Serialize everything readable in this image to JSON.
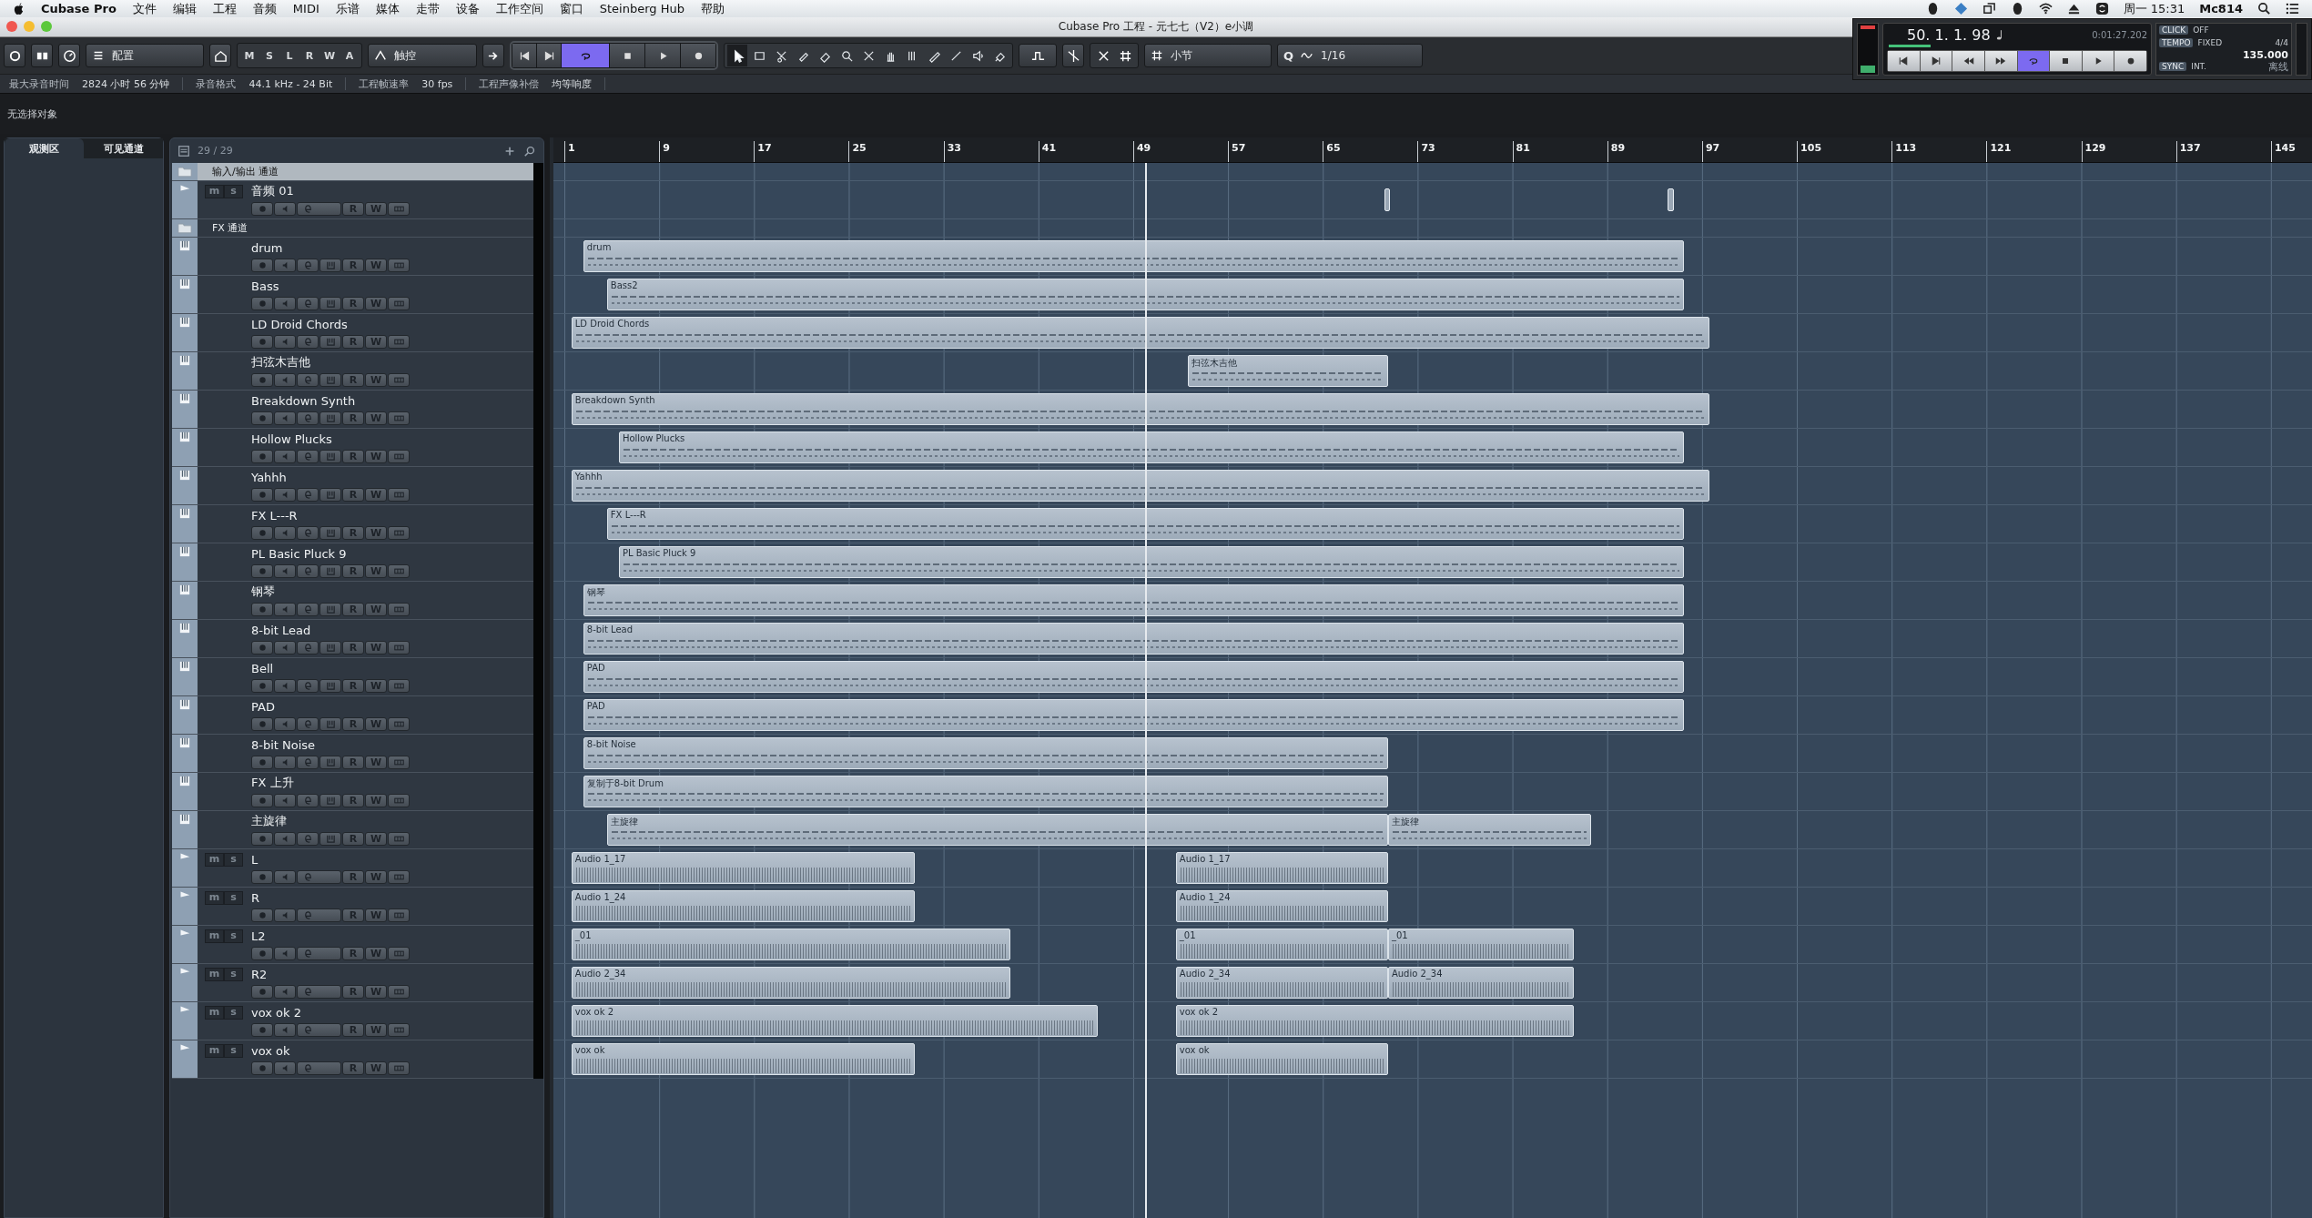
{
  "menu_bar": {
    "app": "Cubase Pro",
    "items": [
      "文件",
      "编辑",
      "工程",
      "音频",
      "MIDI",
      "乐谱",
      "媒体",
      "走带",
      "设备",
      "工作空间",
      "窗口",
      "Steinberg Hub",
      "帮助"
    ],
    "clock": "周一 15:31",
    "user": "Mc814"
  },
  "window": {
    "title": "Cubase Pro 工程 - 元七七（V2）e小调"
  },
  "toolbar": {
    "preset": "配置",
    "modes": [
      "M",
      "S",
      "L",
      "R",
      "W",
      "A"
    ],
    "automation": "触控",
    "transport": [
      {
        "kind": "to-start",
        "on": false
      },
      {
        "kind": "to-end",
        "on": false
      },
      {
        "kind": "cycle",
        "on": true
      },
      {
        "kind": "stop",
        "on": false
      },
      {
        "kind": "play",
        "on": false
      },
      {
        "kind": "record",
        "on": false
      }
    ],
    "grid": "小节",
    "quantize_label": "Q",
    "quantize": "1/16"
  },
  "info_line": [
    {
      "label": "最大录音时间",
      "value": "2824 小时 56 分钟"
    },
    {
      "label": "录音格式",
      "value": "44.1 kHz - 24 Bit"
    },
    {
      "label": "工程帧速率",
      "value": "30 fps"
    },
    {
      "label": "工程声像补偿",
      "value": "均等响度"
    }
  ],
  "selection_status": "无选择对象",
  "inspector": {
    "tabs": [
      {
        "label": "观测区",
        "selected": true
      },
      {
        "label": "可见通道",
        "selected": false
      }
    ]
  },
  "track_list": {
    "count": "29 / 29",
    "tracks": [
      {
        "kind": "folder",
        "name": "输入/输出 通道",
        "selected": true
      },
      {
        "kind": "audio",
        "name": "音频 01",
        "selected": false,
        "mute": "m",
        "solo": "s",
        "read": "R",
        "write": "W",
        "clips": [
          {
            "kind": "marker"
          },
          {
            "kind": "marker"
          }
        ]
      },
      {
        "kind": "folder",
        "name": "FX 通道",
        "selected": false
      },
      {
        "kind": "instrument",
        "name": "drum",
        "selected": false,
        "read": "R",
        "write": "W",
        "clips": [
          {
            "name": "drum"
          }
        ]
      },
      {
        "kind": "instrument",
        "name": "Bass",
        "selected": false,
        "read": "R",
        "write": "W",
        "clips": [
          {
            "name": "Bass2"
          }
        ]
      },
      {
        "kind": "instrument",
        "name": "LD Droid Chords",
        "selected": false,
        "read": "R",
        "write": "W",
        "clips": [
          {
            "name": "LD Droid Chords"
          }
        ]
      },
      {
        "kind": "instrument",
        "name": "扫弦木吉他",
        "selected": false,
        "read": "R",
        "write": "W",
        "clips": [
          {
            "name": "扫弦木吉他"
          }
        ]
      },
      {
        "kind": "instrument",
        "name": "Breakdown Synth",
        "selected": false,
        "read": "R",
        "write": "W",
        "clips": [
          {
            "name": "Breakdown Synth"
          }
        ]
      },
      {
        "kind": "instrument",
        "name": "Hollow Plucks",
        "selected": false,
        "read": "R",
        "write": "W",
        "clips": [
          {
            "name": "Hollow Plucks"
          }
        ]
      },
      {
        "kind": "instrument",
        "name": "Yahhh",
        "selected": false,
        "read": "R",
        "write": "W",
        "clips": [
          {
            "name": "Yahhh"
          }
        ]
      },
      {
        "kind": "instrument",
        "name": "FX L---R",
        "selected": false,
        "read": "R",
        "write": "W",
        "clips": [
          {
            "name": "FX L---R"
          }
        ]
      },
      {
        "kind": "instrument",
        "name": "PL Basic Pluck 9",
        "selected": false,
        "read": "R",
        "write": "W",
        "clips": [
          {
            "name": "PL Basic Pluck 9"
          }
        ]
      },
      {
        "kind": "instrument",
        "name": "钢琴",
        "selected": false,
        "read": "R",
        "write": "W",
        "clips": [
          {
            "name": "钢琴"
          }
        ]
      },
      {
        "kind": "instrument",
        "name": "8-bit Lead",
        "selected": false,
        "read": "R",
        "write": "W",
        "clips": [
          {
            "name": "8-bit Lead"
          }
        ]
      },
      {
        "kind": "instrument",
        "name": "Bell",
        "selected": false,
        "read": "R",
        "write": "W",
        "clips": [
          {
            "name": "PAD"
          }
        ]
      },
      {
        "kind": "instrument",
        "name": "PAD",
        "selected": false,
        "read": "R",
        "write": "W",
        "clips": [
          {
            "name": "PAD"
          }
        ]
      },
      {
        "kind": "instrument",
        "name": "8-bit Noise",
        "selected": false,
        "read": "R",
        "write": "W",
        "clips": [
          {
            "name": "8-bit Noise"
          }
        ]
      },
      {
        "kind": "instrument",
        "name": "FX 上升",
        "selected": false,
        "read": "R",
        "write": "W",
        "clips": [
          {
            "name": "复制于8-bit Drum"
          }
        ]
      },
      {
        "kind": "instrument",
        "name": "主旋律",
        "selected": false,
        "read": "R",
        "write": "W",
        "clips": [
          {
            "name": "主旋律"
          },
          {
            "name": "主旋律"
          }
        ]
      },
      {
        "kind": "audio",
        "name": "L",
        "selected": false,
        "mute": "m",
        "solo": "s",
        "read": "R",
        "write": "W",
        "clips": [
          {
            "name": "Audio 1_17"
          },
          {
            "name": "Audio 1_17"
          }
        ]
      },
      {
        "kind": "audio",
        "name": "R",
        "selected": false,
        "mute": "m",
        "solo": "s",
        "read": "R",
        "write": "W",
        "clips": [
          {
            "name": "Audio 1_24"
          },
          {
            "name": "Audio 1_24"
          }
        ]
      },
      {
        "kind": "audio",
        "name": "L2",
        "selected": false,
        "mute": "m",
        "solo": "s",
        "read": "R",
        "write": "W",
        "clips": [
          {
            "name": "_01"
          },
          {
            "name": "_01"
          },
          {
            "name": "_01"
          }
        ]
      },
      {
        "kind": "audio",
        "name": "R2",
        "selected": false,
        "mute": "m",
        "solo": "s",
        "read": "R",
        "write": "W",
        "clips": [
          {
            "name": "Audio 2_34"
          },
          {
            "name": "Audio 2_34"
          },
          {
            "name": "Audio 2_34"
          }
        ]
      },
      {
        "kind": "audio",
        "name": "vox ok 2",
        "selected": false,
        "mute": "m",
        "solo": "s",
        "read": "R",
        "write": "W",
        "clips": [
          {
            "name": "vox ok 2"
          },
          {
            "name": "vox ok 2"
          }
        ]
      },
      {
        "kind": "audio",
        "name": "vox ok",
        "selected": false,
        "mute": "m",
        "solo": "s",
        "read": "R",
        "write": "W",
        "clips": [
          {
            "name": "vox ok"
          },
          {
            "name": "vox ok"
          }
        ]
      }
    ]
  },
  "ruler": {
    "marks": [
      "1",
      "9",
      "17",
      "25",
      "33",
      "41",
      "49",
      "57",
      "65",
      "73",
      "81",
      "89",
      "97",
      "105",
      "113",
      "121",
      "129",
      "137",
      "145"
    ]
  },
  "transport_panel": {
    "meter": {
      "level": 0.14
    },
    "position": "50. 1. 1. 98",
    "time": "0:01:27.202",
    "buttons": [
      {
        "kind": "to-start",
        "on": false
      },
      {
        "kind": "to-end",
        "on": false
      },
      {
        "kind": "rewind",
        "on": false
      },
      {
        "kind": "forward",
        "on": false
      },
      {
        "kind": "cycle",
        "on": true
      },
      {
        "kind": "stop",
        "on": false
      },
      {
        "kind": "play",
        "on": false
      },
      {
        "kind": "record",
        "on": false
      }
    ],
    "click": {
      "label": "CLICK",
      "value": "OFF"
    },
    "tempo": {
      "label": "TEMPO",
      "mode": "FIXED",
      "signature": "4/4",
      "value": "135.000"
    },
    "sync": {
      "label": "SYNC",
      "value": "INT.",
      "status": "离线"
    }
  }
}
